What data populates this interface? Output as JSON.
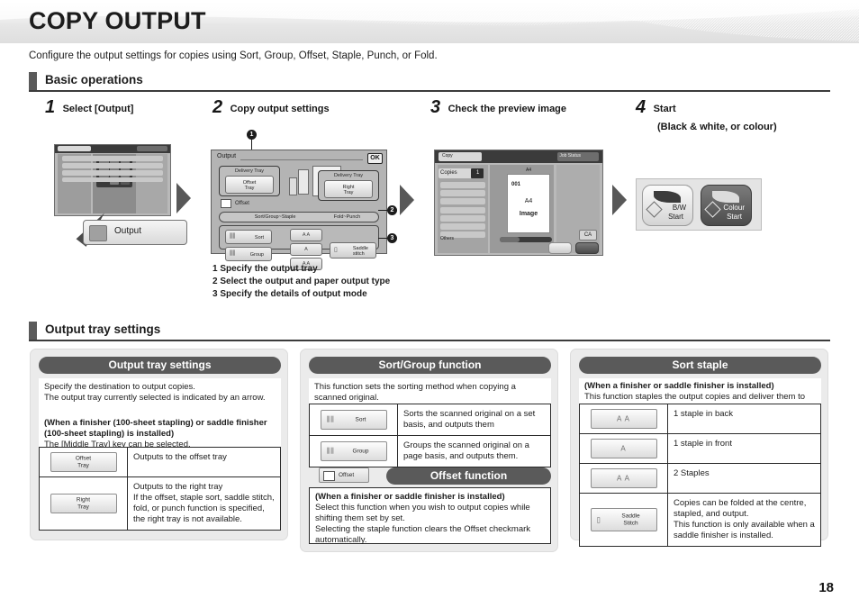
{
  "header": {
    "title": "COPY OUTPUT",
    "intro": "Configure the output settings for copies using Sort, Group, Offset, Staple, Punch, or Fold."
  },
  "sections": {
    "basic": {
      "title": "Basic operations"
    },
    "tray": {
      "title": "Output tray settings"
    }
  },
  "steps": [
    {
      "num": "1",
      "label": "Select [Output]",
      "sub": ""
    },
    {
      "num": "2",
      "label": "Copy output settings",
      "sub": ""
    },
    {
      "num": "3",
      "label": "Check the preview image",
      "sub": ""
    },
    {
      "num": "4",
      "label": "Start",
      "sub": "(Black & white, or colour)"
    }
  ],
  "step1": {
    "callout_label": "Output"
  },
  "step2": {
    "dialog_title": "Output",
    "ok_label": "OK",
    "tray_left_caption": "Delivery Tray",
    "tray_left_key": "Offset\nTray",
    "tray_right_caption": "Delivery Tray",
    "tray_right_key": "Right\nTray",
    "offset_checkbox_label": "Offset",
    "tab1": "Sort/Group~Staple",
    "tab2": "Fold~Punch",
    "sort_key": "Sort",
    "group_key": "Group",
    "saddle_key": "Saddle\nstitch",
    "markers": [
      "1",
      "2",
      "3"
    ],
    "notes": [
      "1 Specify the output tray",
      "2 Select the output and paper output type",
      "3 Specify the details of output mode"
    ]
  },
  "step3": {
    "app_label": "Copy",
    "copies_label": "Copies",
    "copies_value": "1",
    "job_status_label": "Job Status",
    "preview_size_top": "A4",
    "preview_num": "001",
    "preview_size": "A4",
    "preview_image_label": "Image",
    "ca_label": "CA",
    "others_label": "Others"
  },
  "step4": {
    "bw_line1": "B/W",
    "bw_line2": "Start",
    "colour_line1": "Colour",
    "colour_line2": "Start"
  },
  "cards": {
    "output_tray": {
      "pill": "Output tray settings",
      "intro_line1": "Specify the destination to output copies.",
      "intro_line2": "The output tray currently selected is indicated by an arrow.",
      "bold_line1": "(When a finisher (100-sheet stapling) or saddle finisher",
      "bold_line2": "(100-sheet stapling) is installed)",
      "normal_line": "The [Middle Tray] key can be selected.",
      "rows": [
        {
          "key": "Offset\nTray",
          "desc": "Outputs to the offset tray"
        },
        {
          "key": "Right\nTray",
          "desc": "Outputs to the right tray\nIf the offset, staple sort, saddle stitch, fold, or punch function is specified, the right tray is not available."
        }
      ]
    },
    "sort_group": {
      "pill": "Sort/Group function",
      "intro": "This function sets the sorting method when copying a scanned original.",
      "rows": [
        {
          "key": "Sort",
          "desc": "Sorts the scanned original on a set basis, and outputs them"
        },
        {
          "key": "Group",
          "desc": "Groups the scanned original on a page basis, and outputs them."
        }
      ]
    },
    "offset_function": {
      "mini_key_label": "Offset",
      "pill": "Offset function",
      "bold_line": "(When a finisher or saddle finisher is installed)",
      "body_line1": "Select this function when you wish to output copies while shifting them set by set.",
      "body_line2": "Selecting the staple function clears the Offset checkmark automatically."
    },
    "sort_staple": {
      "pill": "Sort staple",
      "bold_line": "(When a finisher or saddle finisher is installed)",
      "intro": "This function staples the output copies and deliver them to the tray.",
      "rows": [
        {
          "key": "",
          "icon": "A A",
          "desc": "1 staple in back"
        },
        {
          "key": "",
          "icon": "A",
          "desc": "1 staple in front"
        },
        {
          "key": "",
          "icon": "A A",
          "desc": "2 Staples"
        },
        {
          "key": "Saddle\nStitch",
          "icon": "",
          "desc": "Copies can be folded at the centre, stapled, and output.\nThis function is only available when a saddle finisher is installed."
        }
      ]
    }
  },
  "footer": {
    "page_number": "18"
  }
}
